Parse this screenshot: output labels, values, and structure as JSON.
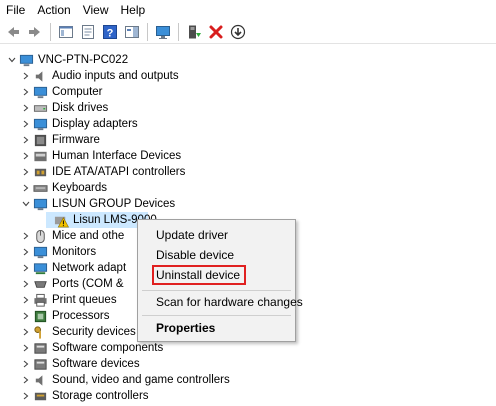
{
  "menu": {
    "file": "File",
    "action": "Action",
    "view": "View",
    "help": "Help"
  },
  "toolbar": {
    "icons": [
      "back-icon",
      "forward-icon",
      "show-hide-console-tree-icon",
      "properties-icon",
      "help-icon",
      "action-pane-icon",
      "monitor-icon",
      "update-driver-icon",
      "uninstall-icon",
      "download-icon"
    ]
  },
  "tree": {
    "root": "VNC-PTN-PC022",
    "items": [
      "Audio inputs and outputs",
      "Computer",
      "Disk drives",
      "Display adapters",
      "Firmware",
      "Human Interface Devices",
      "IDE ATA/ATAPI controllers",
      "Keyboards",
      "LISUN GROUP Devices",
      "Lisun LMS-9000",
      "Mice and othe",
      "Monitors",
      "Network adapt",
      "Ports (COM &",
      "Print queues",
      "Processors",
      "Security devices",
      "Software components",
      "Software devices",
      "Sound, video and game controllers",
      "Storage controllers"
    ]
  },
  "context_menu": {
    "update_driver": "Update driver",
    "disable_device": "Disable device",
    "uninstall_device": "Uninstall device",
    "scan": "Scan for hardware changes",
    "properties": "Properties",
    "highlight_color": "#e02020"
  },
  "colors": {
    "selection": "#cce8ff",
    "menu_bg": "#f2f2f2"
  }
}
